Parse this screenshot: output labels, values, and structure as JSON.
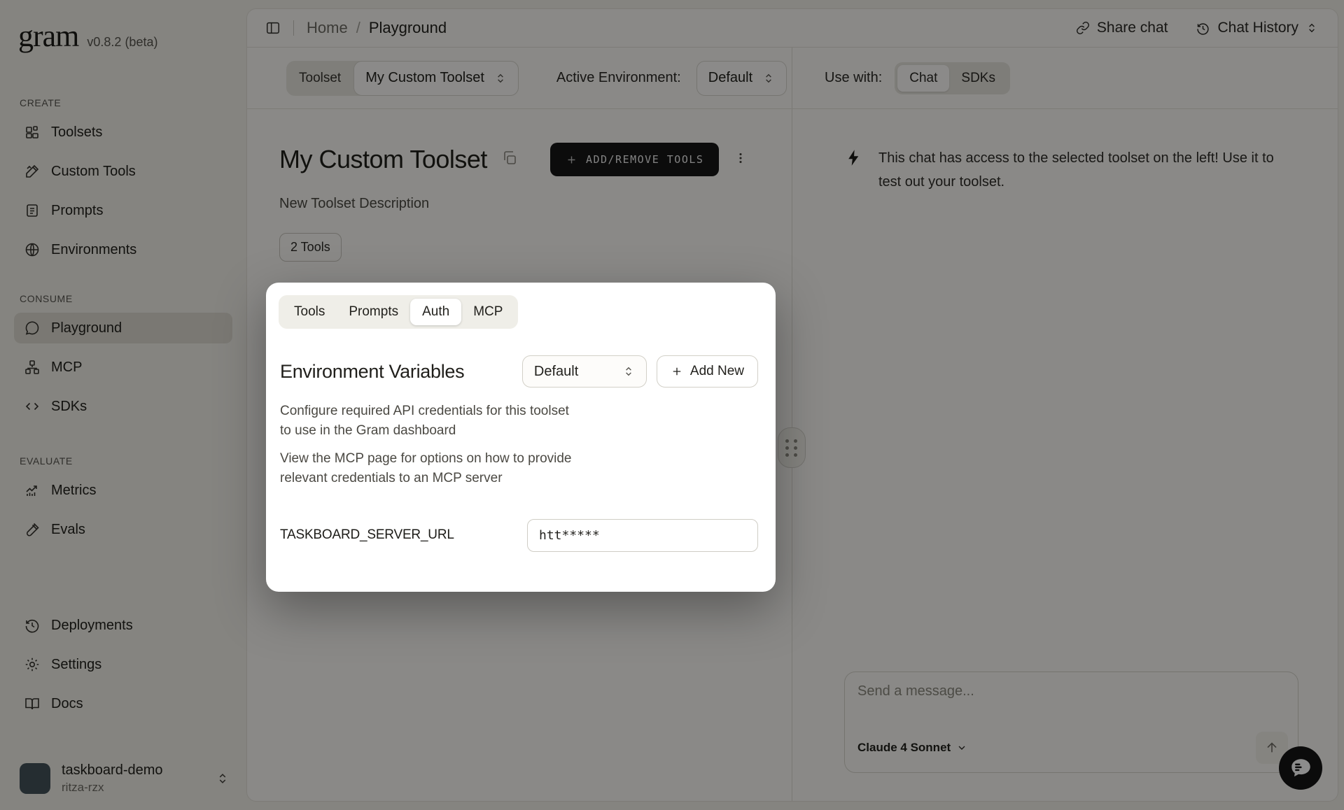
{
  "app": {
    "name": "gram",
    "version": "v0.8.2 (beta)"
  },
  "sidebar": {
    "sections": [
      {
        "label": "CREATE",
        "items": [
          {
            "icon": "toolsets-icon",
            "label": "Toolsets"
          },
          {
            "icon": "custom-tools-icon",
            "label": "Custom Tools"
          },
          {
            "icon": "prompts-icon",
            "label": "Prompts"
          },
          {
            "icon": "environments-icon",
            "label": "Environments"
          }
        ]
      },
      {
        "label": "CONSUME",
        "items": [
          {
            "icon": "playground-icon",
            "label": "Playground",
            "active": true
          },
          {
            "icon": "mcp-icon",
            "label": "MCP"
          },
          {
            "icon": "sdks-icon",
            "label": "SDKs"
          }
        ]
      },
      {
        "label": "EVALUATE",
        "items": [
          {
            "icon": "metrics-icon",
            "label": "Metrics"
          },
          {
            "icon": "evals-icon",
            "label": "Evals"
          }
        ]
      }
    ],
    "footer_items": [
      {
        "icon": "deployments-icon",
        "label": "Deployments"
      },
      {
        "icon": "settings-icon",
        "label": "Settings"
      },
      {
        "icon": "docs-icon",
        "label": "Docs"
      }
    ],
    "account": {
      "name": "taskboard-demo",
      "org": "ritza-rzx"
    }
  },
  "topbar": {
    "breadcrumb": {
      "home": "Home",
      "separator": "/",
      "current": "Playground"
    },
    "share_chat": "Share chat",
    "chat_history": "Chat History"
  },
  "toolbar": {
    "toolset_label": "Toolset",
    "toolset_value": "My Custom Toolset",
    "env_label": "Active Environment:",
    "env_value": "Default",
    "use_with_label": "Use with:",
    "segments": [
      "Chat",
      "SDKs"
    ],
    "active_segment": "Chat"
  },
  "main": {
    "title": "My Custom Toolset",
    "add_remove_button": "ADD/REMOVE TOOLS",
    "description": "New Toolset Description",
    "tools_badge": "2 Tools"
  },
  "modal": {
    "tabs": [
      "Tools",
      "Prompts",
      "Auth",
      "MCP"
    ],
    "active_tab": "Auth",
    "heading": "Environment Variables",
    "env_select_value": "Default",
    "add_new_button": "Add New",
    "paragraph1": "Configure required API credentials for this toolset to use in the Gram dashboard",
    "paragraph2": "View the MCP page for options on how to provide relevant credentials to an MCP server",
    "env_var": {
      "name": "TASKBOARD_SERVER_URL",
      "value": "htt*****"
    }
  },
  "chat": {
    "info_text": "This chat has access to the selected toolset on the left! Use it to test out your toolset.",
    "input_placeholder": "Send a message...",
    "model_label": "Claude 4 Sonnet"
  },
  "colors": {
    "accent_black": "#171717",
    "page_bg": "#f2f0e9",
    "card_bg": "#fbfaf6",
    "selected_pill": "#dedbd2",
    "overlay": "rgba(0,0,0,0.45)"
  }
}
